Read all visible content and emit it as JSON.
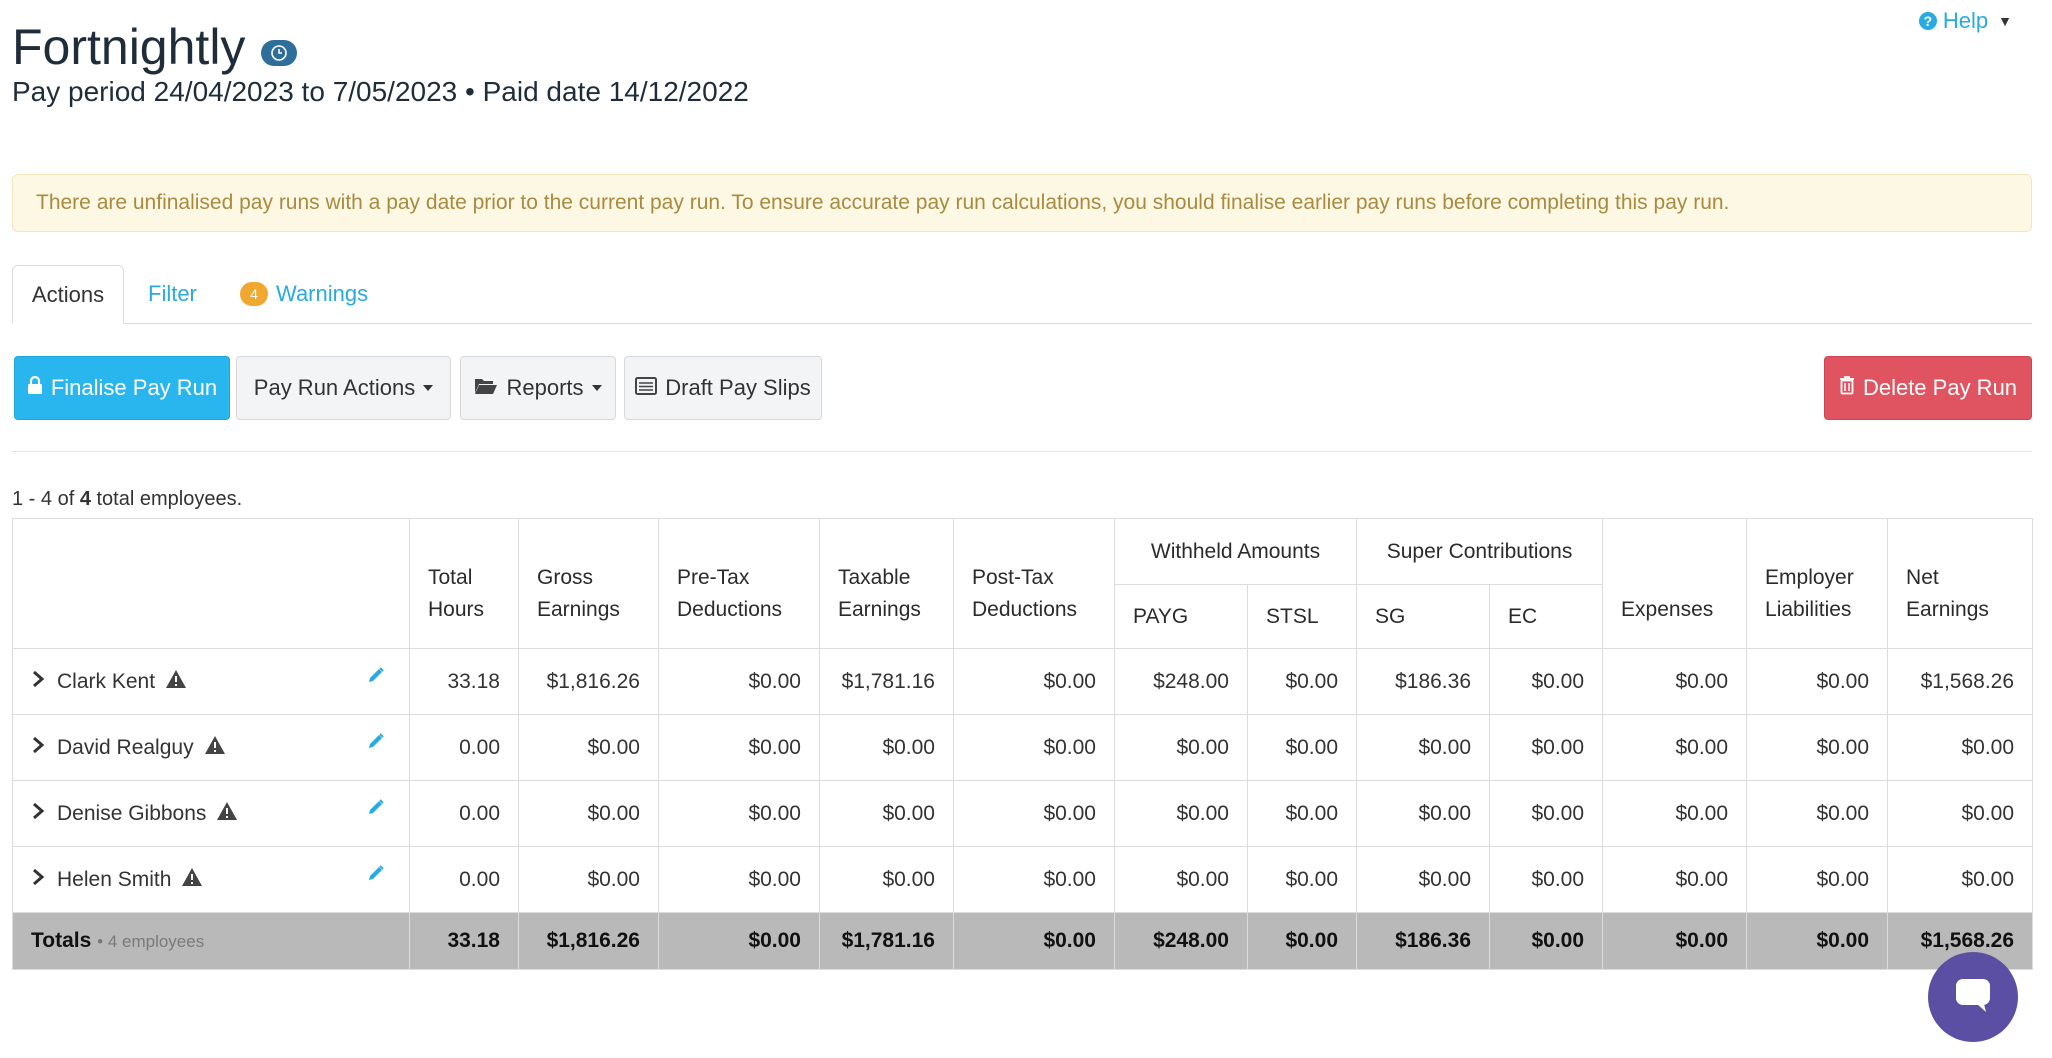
{
  "header": {
    "title": "Fortnightly",
    "subtitle": "Pay period 24/04/2023 to 7/05/2023 • Paid date 14/12/2022",
    "help_label": "Help"
  },
  "alert": {
    "text": "There are unfinalised pay runs with a pay date prior to the current pay run. To ensure accurate pay run calculations, you should finalise earlier pay runs before completing this pay run."
  },
  "tabs": {
    "actions": "Actions",
    "filter": "Filter",
    "warnings": "Warnings",
    "warnings_count": "4"
  },
  "toolbar": {
    "finalise": "Finalise Pay Run",
    "pay_run_actions": "Pay Run Actions",
    "reports": "Reports",
    "draft_pay_slips": "Draft Pay Slips",
    "delete": "Delete Pay Run"
  },
  "summary": {
    "range": "1 - 4 of ",
    "total": "4",
    "suffix": " total employees."
  },
  "table": {
    "headers": {
      "total_hours": "Total Hours",
      "gross_earnings": "Gross Earnings",
      "pre_tax": "Pre-Tax Deductions",
      "taxable": "Taxable Earnings",
      "post_tax": "Post-Tax Deductions",
      "withheld": "Withheld Amounts",
      "payg": "PAYG",
      "stsl": "STSL",
      "super": "Super Contributions",
      "sg": "SG",
      "ec": "EC",
      "expenses": "Expenses",
      "employer_liabilities": "Employer Liabilities",
      "net_earnings": "Net Earnings"
    },
    "rows": [
      {
        "name": "Clark Kent",
        "hours": "33.18",
        "gross": "$1,816.26",
        "pretax": "$0.00",
        "taxable": "$1,781.16",
        "posttax": "$0.00",
        "payg": "$248.00",
        "stsl": "$0.00",
        "sg": "$186.36",
        "ec": "$0.00",
        "expenses": "$0.00",
        "liabilities": "$0.00",
        "net": "$1,568.26"
      },
      {
        "name": "David Realguy",
        "hours": "0.00",
        "gross": "$0.00",
        "pretax": "$0.00",
        "taxable": "$0.00",
        "posttax": "$0.00",
        "payg": "$0.00",
        "stsl": "$0.00",
        "sg": "$0.00",
        "ec": "$0.00",
        "expenses": "$0.00",
        "liabilities": "$0.00",
        "net": "$0.00"
      },
      {
        "name": "Denise Gibbons",
        "hours": "0.00",
        "gross": "$0.00",
        "pretax": "$0.00",
        "taxable": "$0.00",
        "posttax": "$0.00",
        "payg": "$0.00",
        "stsl": "$0.00",
        "sg": "$0.00",
        "ec": "$0.00",
        "expenses": "$0.00",
        "liabilities": "$0.00",
        "net": "$0.00"
      },
      {
        "name": "Helen Smith",
        "hours": "0.00",
        "gross": "$0.00",
        "pretax": "$0.00",
        "taxable": "$0.00",
        "posttax": "$0.00",
        "payg": "$0.00",
        "stsl": "$0.00",
        "sg": "$0.00",
        "ec": "$0.00",
        "expenses": "$0.00",
        "liabilities": "$0.00",
        "net": "$0.00"
      }
    ],
    "totals": {
      "label": "Totals",
      "sub": "• 4 employees",
      "hours": "33.18",
      "gross": "$1,816.26",
      "pretax": "$0.00",
      "taxable": "$1,781.16",
      "posttax": "$0.00",
      "payg": "$248.00",
      "stsl": "$0.00",
      "sg": "$186.36",
      "ec": "$0.00",
      "expenses": "$0.00",
      "liabilities": "$0.00",
      "net": "$1,568.26"
    }
  },
  "icons": {
    "clock": "clock-icon",
    "help": "question-circle-icon",
    "lock": "lock-icon",
    "folder": "folder-open-icon",
    "list": "list-icon",
    "trash": "trash-icon",
    "expand": "chevron-right-icon",
    "warning": "warning-triangle-icon",
    "edit": "pencil-icon",
    "chat": "chat-icon"
  },
  "colors": {
    "primary": "#29b6ee",
    "danger": "#e05461",
    "link": "#29abe2",
    "warning_badge": "#f0a830",
    "alert_bg": "#fcf8e3",
    "alert_text": "#a98a40",
    "chat": "#5a4fa3"
  }
}
